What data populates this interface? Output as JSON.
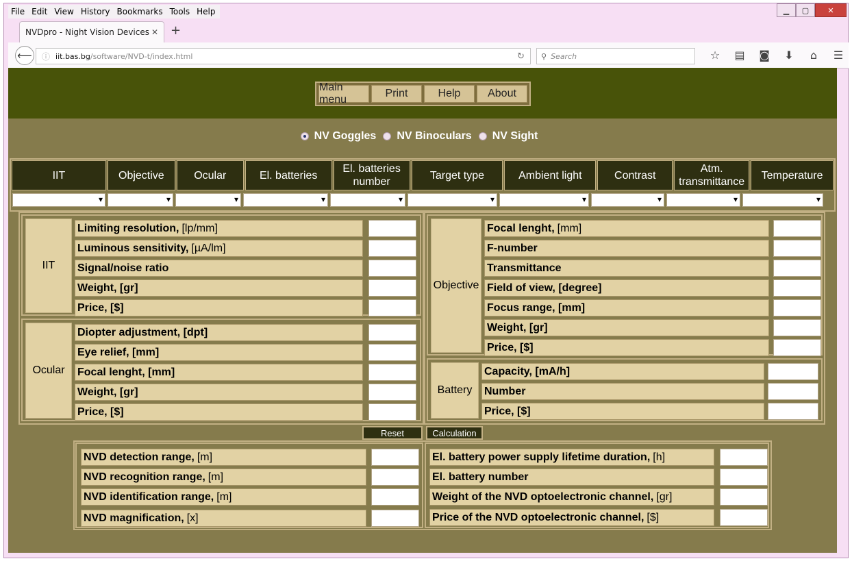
{
  "browser": {
    "menu": [
      "File",
      "Edit",
      "View",
      "History",
      "Bookmarks",
      "Tools",
      "Help"
    ],
    "tab_title": "NVDpro - Night Vision Devices ...",
    "url_host": "iit.bas.bg",
    "url_path": "/software/NVD-t/index.html",
    "search_placeholder": "Search"
  },
  "top_menu": [
    "Main menu",
    "Print",
    "Help",
    "About"
  ],
  "device_types": [
    {
      "label": "NV Goggles",
      "selected": true
    },
    {
      "label": "NV Binoculars",
      "selected": false
    },
    {
      "label": "NV Sight",
      "selected": false
    }
  ],
  "selectors": [
    "IIT",
    "Objective",
    "Ocular",
    "El. batteries",
    "El. batteries number",
    "Target type",
    "Ambient light",
    "Contrast",
    "Atm. transmittance",
    "Temperature"
  ],
  "groups": {
    "iit": {
      "label": "IIT",
      "params": [
        {
          "name": "Limiting resolution,",
          "unit": "[lp/mm]"
        },
        {
          "name": "Luminous sensitivity,",
          "unit": "[µA/lm]"
        },
        {
          "name": "Signal/noise ratio",
          "unit": ""
        },
        {
          "name": "Weight, [gr]",
          "unit": ""
        },
        {
          "name": "Price, [$]",
          "unit": ""
        }
      ]
    },
    "ocular": {
      "label": "Ocular",
      "params": [
        {
          "name": "Diopter adjustment, [dpt]",
          "unit": ""
        },
        {
          "name": "Eye relief, [mm]",
          "unit": ""
        },
        {
          "name": "Focal lenght, [mm]",
          "unit": ""
        },
        {
          "name": "Weight, [gr]",
          "unit": ""
        },
        {
          "name": "Price, [$]",
          "unit": ""
        }
      ]
    },
    "objective": {
      "label": "Objective",
      "params": [
        {
          "name": "Focal lenght,",
          "unit": "[mm]"
        },
        {
          "name": "F-number",
          "unit": ""
        },
        {
          "name": "Transmittance",
          "unit": ""
        },
        {
          "name": "Field of view, [degree]",
          "unit": ""
        },
        {
          "name": "Focus range, [mm]",
          "unit": ""
        },
        {
          "name": "Weight, [gr]",
          "unit": ""
        },
        {
          "name": "Price, [$]",
          "unit": ""
        }
      ]
    },
    "battery": {
      "label": "Battery",
      "params": [
        {
          "name": "Capacity, [mA/h]",
          "unit": ""
        },
        {
          "name": "Number",
          "unit": ""
        },
        {
          "name": "Price, [$]",
          "unit": ""
        }
      ]
    }
  },
  "actions": {
    "reset": "Reset",
    "calculate": "Calculation"
  },
  "results_left": [
    {
      "name": "NVD detection range,",
      "unit": "[m]"
    },
    {
      "name": "NVD recognition range,",
      "unit": "[m]"
    },
    {
      "name": "NVD identification range,",
      "unit": "[m]"
    },
    {
      "name": "NVD magnification,",
      "unit": "[x]"
    }
  ],
  "results_right": [
    {
      "name": "El. battery power supply lifetime duration,",
      "unit": "[h]"
    },
    {
      "name": "El. battery number",
      "unit": ""
    },
    {
      "name": "Weight of the NVD optoelectronic channel,",
      "unit": "[gr]"
    },
    {
      "name": "Price of the NVD optoelectronic channel,",
      "unit": "[$]"
    }
  ]
}
